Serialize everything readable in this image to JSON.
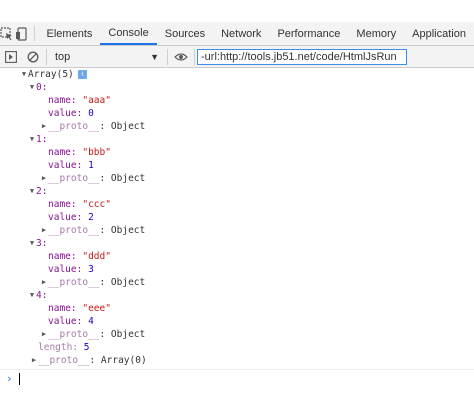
{
  "tabs": {
    "items": [
      "Elements",
      "Console",
      "Sources",
      "Network",
      "Performance",
      "Memory",
      "Application"
    ],
    "active": "Console"
  },
  "toolbar": {
    "context_value": "top",
    "filter_value": "-url:http://tools.jb51.net/code/HtmlJsRun"
  },
  "console": {
    "array_header": "Array(5)",
    "info_badge": "i",
    "items": [
      {
        "index": "0:",
        "name_key": "name:",
        "name_val": "\"aaa\"",
        "value_key": "value:",
        "value_val": "0",
        "proto_key": "__proto__",
        "proto_val": ": Object"
      },
      {
        "index": "1:",
        "name_key": "name:",
        "name_val": "\"bbb\"",
        "value_key": "value:",
        "value_val": "1",
        "proto_key": "__proto__",
        "proto_val": ": Object"
      },
      {
        "index": "2:",
        "name_key": "name:",
        "name_val": "\"ccc\"",
        "value_key": "value:",
        "value_val": "2",
        "proto_key": "__proto__",
        "proto_val": ": Object"
      },
      {
        "index": "3:",
        "name_key": "name:",
        "name_val": "\"ddd\"",
        "value_key": "value:",
        "value_val": "3",
        "proto_key": "__proto__",
        "proto_val": ": Object"
      },
      {
        "index": "4:",
        "name_key": "name:",
        "name_val": "\"eee\"",
        "value_key": "value:",
        "value_val": "4",
        "proto_key": "__proto__",
        "proto_val": ": Object"
      }
    ],
    "length_key": "length:",
    "length_val": "5",
    "array_proto_key": "__proto__",
    "array_proto_val": ": Array(0)",
    "prompt": "›"
  },
  "colors": {
    "accent": "#1a73e8",
    "key": "#881391",
    "string": "#c41a16",
    "number": "#1c00cf"
  }
}
